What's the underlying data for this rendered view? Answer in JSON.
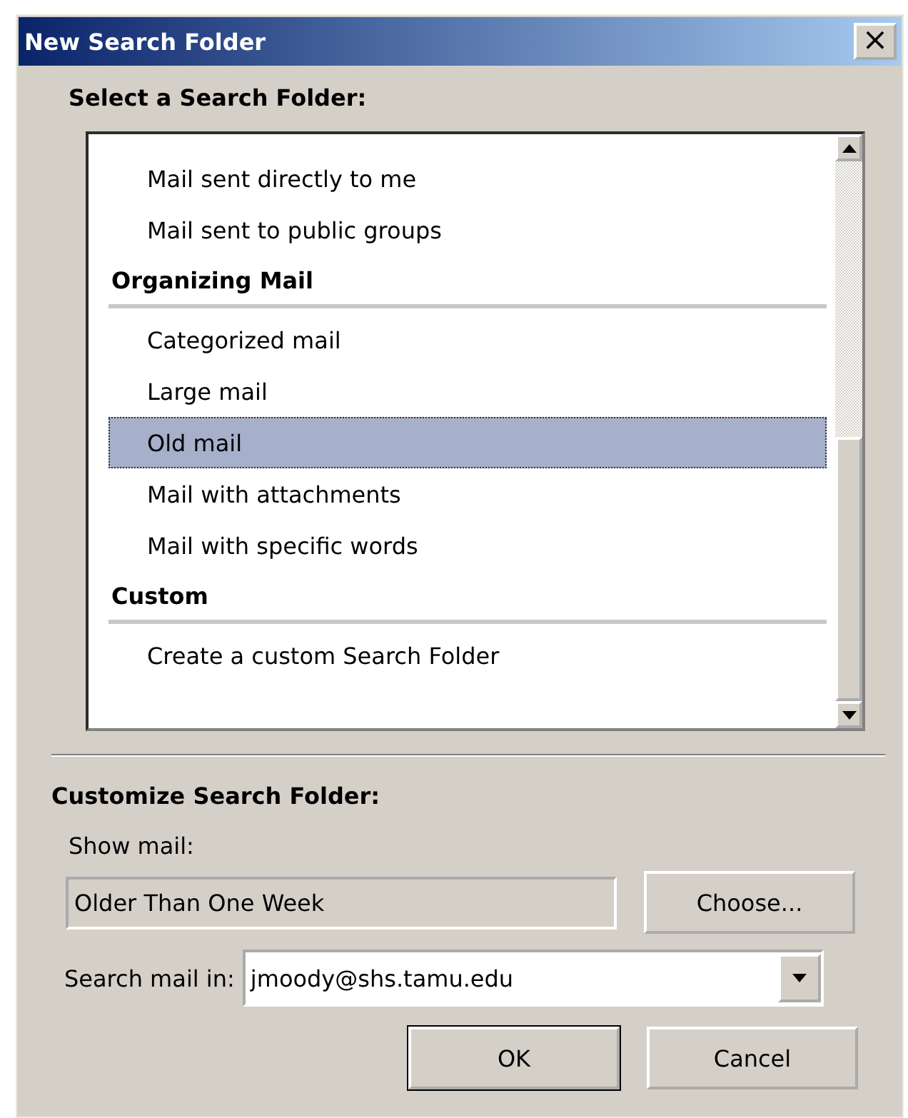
{
  "window": {
    "title": "New Search Folder",
    "close": "×"
  },
  "folder_list": {
    "label": "Select a Search Folder:",
    "groups": [
      {
        "items": [
          {
            "label": "Mail sent directly to me",
            "selected": false
          },
          {
            "label": "Mail sent to public groups",
            "selected": false
          }
        ]
      },
      {
        "heading": "Organizing Mail",
        "items": [
          {
            "label": "Categorized mail",
            "selected": false
          },
          {
            "label": "Large mail",
            "selected": false
          },
          {
            "label": "Old mail",
            "selected": true
          },
          {
            "label": "Mail with attachments",
            "selected": false
          },
          {
            "label": "Mail with specific words",
            "selected": false
          }
        ]
      },
      {
        "heading": "Custom",
        "items": [
          {
            "label": "Create a custom Search Folder",
            "selected": false
          }
        ]
      }
    ]
  },
  "customize": {
    "heading": "Customize Search Folder:",
    "show_mail_label": "Show mail:",
    "show_mail_value": "Older Than One Week",
    "choose_button": "Choose...",
    "search_in_label": "Search mail in:",
    "search_in_value": "jmoody@shs.tamu.edu"
  },
  "buttons": [
    "OK",
    "Cancel"
  ]
}
